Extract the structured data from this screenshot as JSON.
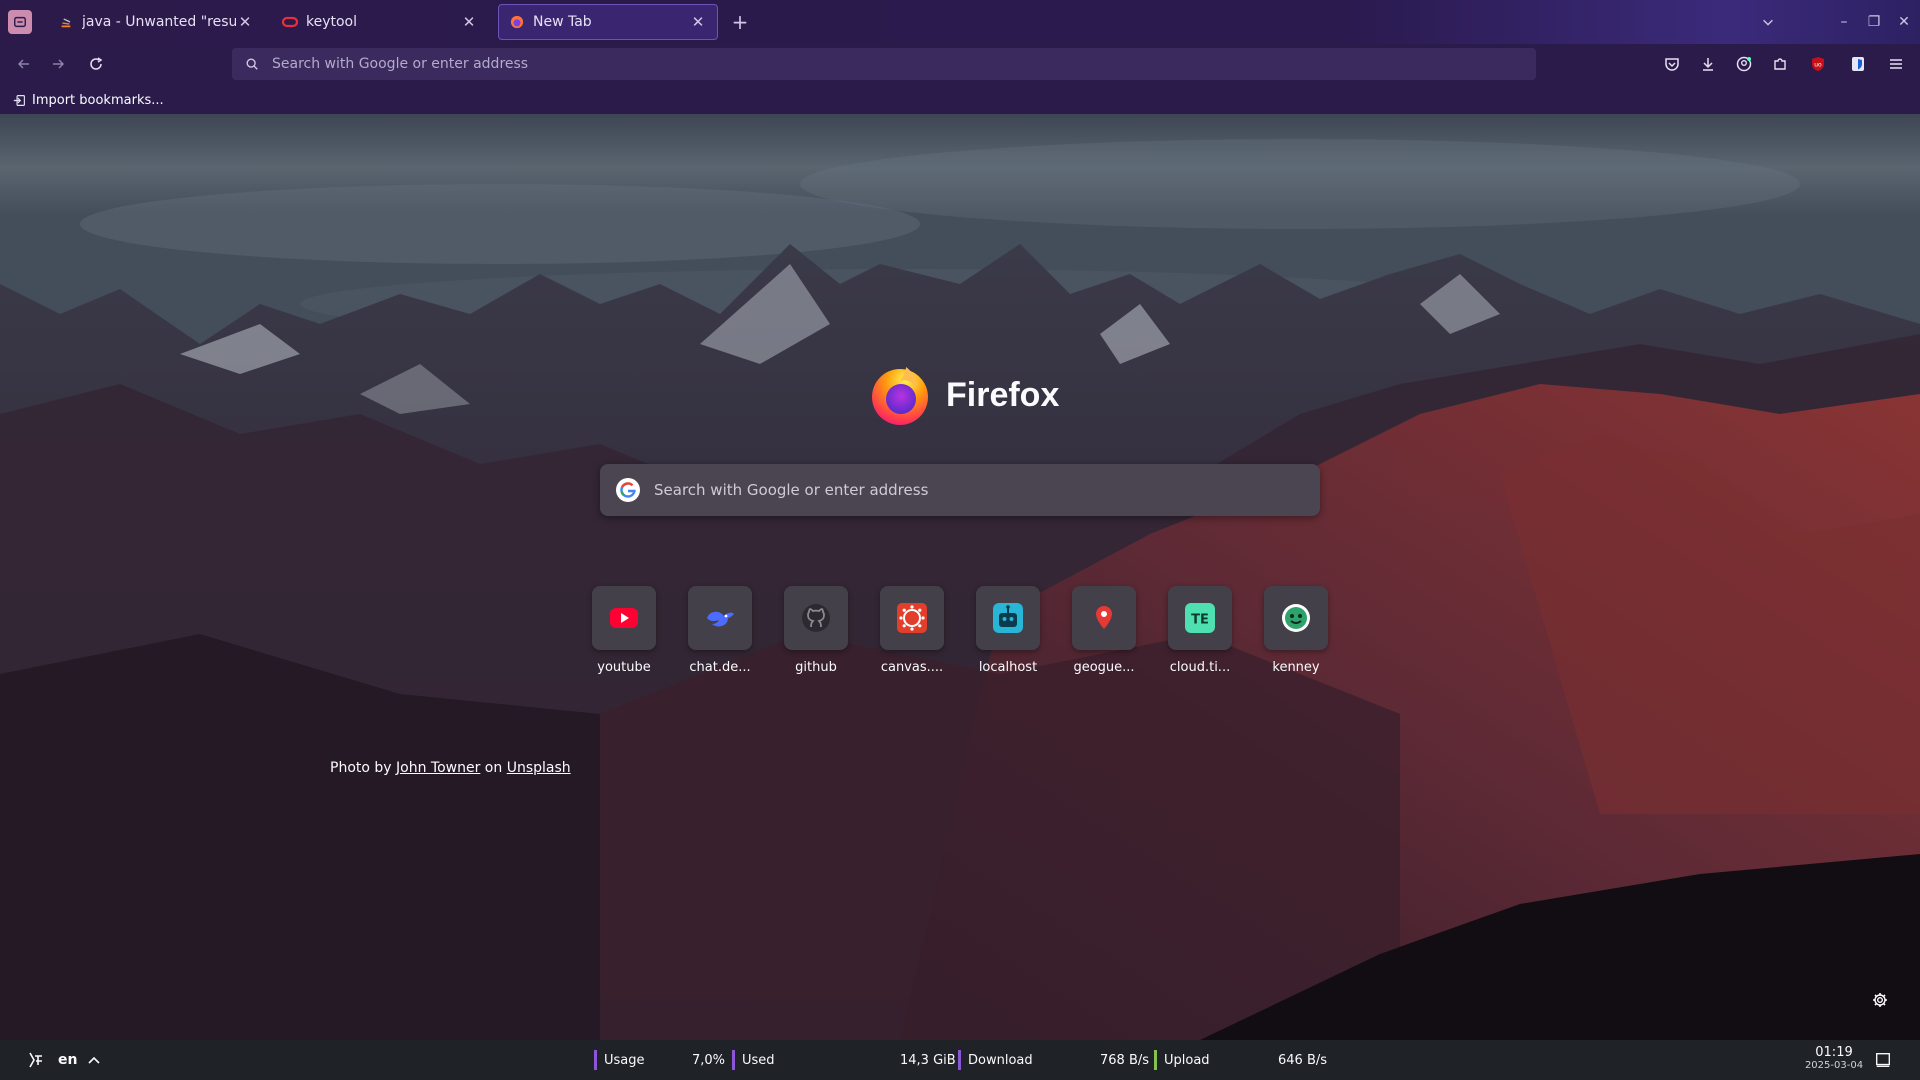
{
  "tabs": [
    {
      "title": "java - Unwanted \"result\" V",
      "favicon": "stackoverflow-icon",
      "active": false
    },
    {
      "title": "keytool",
      "favicon": "oracle-icon",
      "active": false
    },
    {
      "title": "New Tab",
      "favicon": "firefox-icon",
      "active": true
    }
  ],
  "toolbar": {
    "url_placeholder": "Search with Google or enter address"
  },
  "bookmarks": {
    "import_label": "Import bookmarks..."
  },
  "newtab": {
    "brand": "Firefox",
    "search_placeholder": "Search with Google or enter address",
    "shortcuts": [
      {
        "label": "youtube",
        "icon": "youtube-icon",
        "color": "#ff0033"
      },
      {
        "label": "chat.de...",
        "icon": "deepseek-icon",
        "color": "#4d6bfe"
      },
      {
        "label": "github",
        "icon": "github-icon",
        "color": "#1b1f24"
      },
      {
        "label": "canvas....",
        "icon": "canvas-icon",
        "color": "#e13f2b"
      },
      {
        "label": "localhost",
        "icon": "robot-icon",
        "color": "#29b6d6"
      },
      {
        "label": "geogue...",
        "icon": "map-pin-icon",
        "color": "#e53935"
      },
      {
        "label": "cloud.ti...",
        "icon": "te-icon",
        "color": "#4ee0b0"
      },
      {
        "label": "kenney",
        "icon": "kenney-icon",
        "color": "#2ea36b"
      }
    ],
    "credit": {
      "prefix": "Photo by",
      "author": "John Towner",
      "middle": "on",
      "site": "Unsplash"
    }
  },
  "taskbar": {
    "lang": "en",
    "usage_label": "Usage",
    "usage_value": "7,0%",
    "used_label": "Used",
    "used_value": "14,3 GiB",
    "download_label": "Download",
    "download_value": "768 B/s",
    "upload_label": "Upload",
    "upload_value": "646 B/s",
    "time": "01:19",
    "date": "2025-03-04"
  },
  "colors": {
    "accent": "#6a54b8",
    "toolbar_bg": "#2a1b4a",
    "usage_bar": "#8a55d6",
    "upload_bar": "#86c04f"
  }
}
